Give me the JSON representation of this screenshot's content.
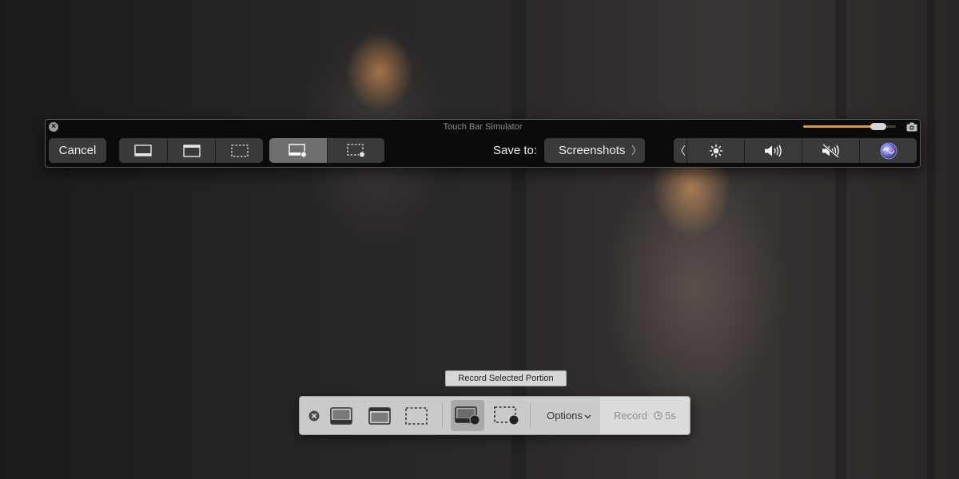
{
  "touchbar_window": {
    "title": "Touch Bar Simulator",
    "opacity_slider_level": 0.88,
    "cancel_label": "Cancel",
    "save_to_label": "Save to:",
    "save_location": "Screenshots",
    "save_chevron": "〉",
    "back_chevron": "〈",
    "accent_color": "#f0951f",
    "capture_modes": [
      {
        "icon": "capture-entire-screen-icon",
        "selected": false
      },
      {
        "icon": "capture-window-icon",
        "selected": false
      },
      {
        "icon": "capture-selection-icon",
        "selected": false
      }
    ],
    "record_modes": [
      {
        "icon": "record-entire-screen-icon",
        "selected": true
      },
      {
        "icon": "record-selection-icon",
        "selected": false
      }
    ],
    "control_strip": [
      "brightness-icon",
      "volume-icon",
      "mute-icon",
      "siri-icon"
    ]
  },
  "screenshot_toolbar": {
    "tooltip": "Record Selected Portion",
    "options_label": "Options",
    "record_label": "Record",
    "timer_label": "5s",
    "items": [
      {
        "icon": "capture-entire-screen-icon",
        "selected": false
      },
      {
        "icon": "capture-window-icon",
        "selected": false
      },
      {
        "icon": "capture-selection-icon",
        "selected": false
      },
      {
        "icon": "record-entire-screen-icon",
        "selected": true
      },
      {
        "icon": "record-selection-icon",
        "selected": false
      }
    ]
  }
}
